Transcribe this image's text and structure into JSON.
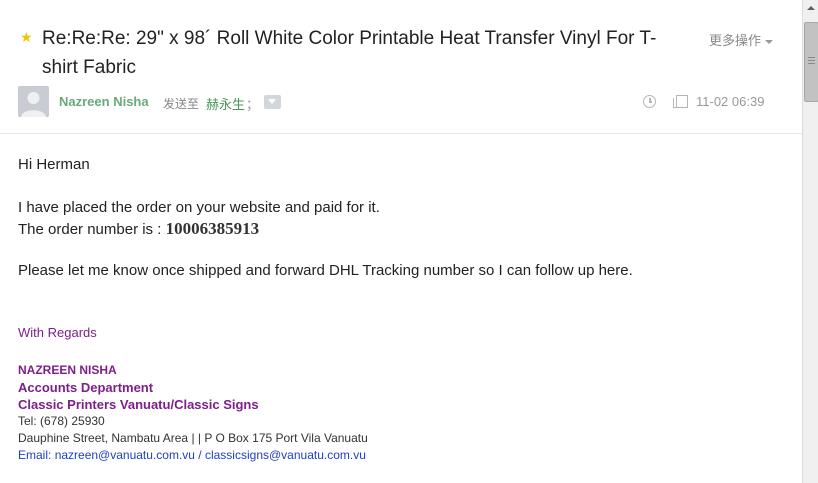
{
  "header": {
    "subject": "Re:Re:Re: 29\" x 98´ Roll White Color Printable Heat Transfer Vinyl For T-shirt Fabric",
    "more_ops_label": "更多操作",
    "sender_name": "Nazreen Nisha",
    "sent_to_label": "发送至",
    "recipient_name": "赫永生",
    "recipient_separator": "；",
    "date": "11-02 06:39",
    "star_color": "#f5c400",
    "sender_color": "#6aa97a"
  },
  "body": {
    "greeting": "Hi Herman",
    "line1": "I have placed the order on your website  and paid for it.",
    "order_prefix": "The order number is : ",
    "order_number": "10006385913",
    "line3": "Please let me know once shipped and forward DHL Tracking number so I can follow up here."
  },
  "signature": {
    "regards": "With Regards",
    "name": "NAZREEN NISHA",
    "department": "Accounts Department",
    "company": "Classic Printers Vanuatu/Classic Signs",
    "tel": "Tel: (678) 25930",
    "address": "Dauphine Street, Nambatu Area  | | P O Box 175 Port Vila Vanuatu",
    "email_label": "Email: ",
    "email1": "nazreen@vanuatu.com.vu",
    "email_separator": " / ",
    "email2": "classicsigns@vanuatu.com.vu",
    "accent_color": "#7d1f8c",
    "link_color": "#1e3fc8"
  },
  "icons": {
    "star": "star-icon",
    "avatar": "avatar-placeholder-icon",
    "expand": "chevron-down-icon",
    "clock": "clock-icon",
    "copy": "copy-icon"
  }
}
